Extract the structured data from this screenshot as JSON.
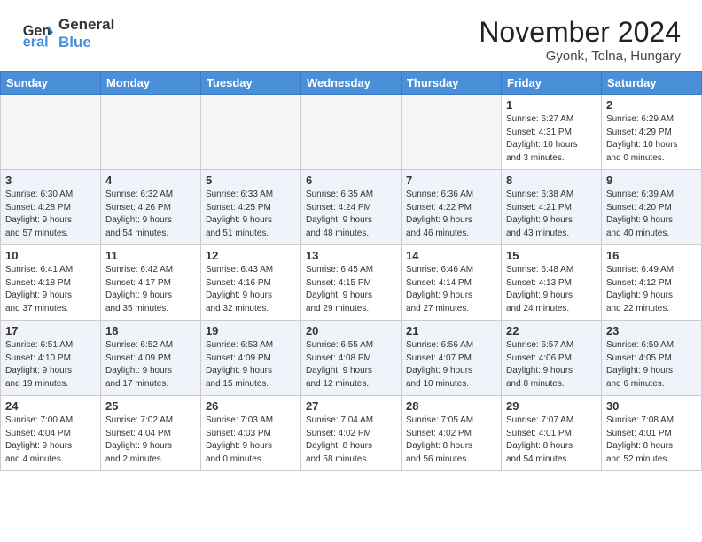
{
  "header": {
    "logo_line1": "General",
    "logo_line2": "Blue",
    "month": "November 2024",
    "location": "Gyonk, Tolna, Hungary"
  },
  "days_of_week": [
    "Sunday",
    "Monday",
    "Tuesday",
    "Wednesday",
    "Thursday",
    "Friday",
    "Saturday"
  ],
  "weeks": [
    [
      {
        "day": "",
        "info": ""
      },
      {
        "day": "",
        "info": ""
      },
      {
        "day": "",
        "info": ""
      },
      {
        "day": "",
        "info": ""
      },
      {
        "day": "",
        "info": ""
      },
      {
        "day": "1",
        "info": "Sunrise: 6:27 AM\nSunset: 4:31 PM\nDaylight: 10 hours\nand 3 minutes."
      },
      {
        "day": "2",
        "info": "Sunrise: 6:29 AM\nSunset: 4:29 PM\nDaylight: 10 hours\nand 0 minutes."
      }
    ],
    [
      {
        "day": "3",
        "info": "Sunrise: 6:30 AM\nSunset: 4:28 PM\nDaylight: 9 hours\nand 57 minutes."
      },
      {
        "day": "4",
        "info": "Sunrise: 6:32 AM\nSunset: 4:26 PM\nDaylight: 9 hours\nand 54 minutes."
      },
      {
        "day": "5",
        "info": "Sunrise: 6:33 AM\nSunset: 4:25 PM\nDaylight: 9 hours\nand 51 minutes."
      },
      {
        "day": "6",
        "info": "Sunrise: 6:35 AM\nSunset: 4:24 PM\nDaylight: 9 hours\nand 48 minutes."
      },
      {
        "day": "7",
        "info": "Sunrise: 6:36 AM\nSunset: 4:22 PM\nDaylight: 9 hours\nand 46 minutes."
      },
      {
        "day": "8",
        "info": "Sunrise: 6:38 AM\nSunset: 4:21 PM\nDaylight: 9 hours\nand 43 minutes."
      },
      {
        "day": "9",
        "info": "Sunrise: 6:39 AM\nSunset: 4:20 PM\nDaylight: 9 hours\nand 40 minutes."
      }
    ],
    [
      {
        "day": "10",
        "info": "Sunrise: 6:41 AM\nSunset: 4:18 PM\nDaylight: 9 hours\nand 37 minutes."
      },
      {
        "day": "11",
        "info": "Sunrise: 6:42 AM\nSunset: 4:17 PM\nDaylight: 9 hours\nand 35 minutes."
      },
      {
        "day": "12",
        "info": "Sunrise: 6:43 AM\nSunset: 4:16 PM\nDaylight: 9 hours\nand 32 minutes."
      },
      {
        "day": "13",
        "info": "Sunrise: 6:45 AM\nSunset: 4:15 PM\nDaylight: 9 hours\nand 29 minutes."
      },
      {
        "day": "14",
        "info": "Sunrise: 6:46 AM\nSunset: 4:14 PM\nDaylight: 9 hours\nand 27 minutes."
      },
      {
        "day": "15",
        "info": "Sunrise: 6:48 AM\nSunset: 4:13 PM\nDaylight: 9 hours\nand 24 minutes."
      },
      {
        "day": "16",
        "info": "Sunrise: 6:49 AM\nSunset: 4:12 PM\nDaylight: 9 hours\nand 22 minutes."
      }
    ],
    [
      {
        "day": "17",
        "info": "Sunrise: 6:51 AM\nSunset: 4:10 PM\nDaylight: 9 hours\nand 19 minutes."
      },
      {
        "day": "18",
        "info": "Sunrise: 6:52 AM\nSunset: 4:09 PM\nDaylight: 9 hours\nand 17 minutes."
      },
      {
        "day": "19",
        "info": "Sunrise: 6:53 AM\nSunset: 4:09 PM\nDaylight: 9 hours\nand 15 minutes."
      },
      {
        "day": "20",
        "info": "Sunrise: 6:55 AM\nSunset: 4:08 PM\nDaylight: 9 hours\nand 12 minutes."
      },
      {
        "day": "21",
        "info": "Sunrise: 6:56 AM\nSunset: 4:07 PM\nDaylight: 9 hours\nand 10 minutes."
      },
      {
        "day": "22",
        "info": "Sunrise: 6:57 AM\nSunset: 4:06 PM\nDaylight: 9 hours\nand 8 minutes."
      },
      {
        "day": "23",
        "info": "Sunrise: 6:59 AM\nSunset: 4:05 PM\nDaylight: 9 hours\nand 6 minutes."
      }
    ],
    [
      {
        "day": "24",
        "info": "Sunrise: 7:00 AM\nSunset: 4:04 PM\nDaylight: 9 hours\nand 4 minutes."
      },
      {
        "day": "25",
        "info": "Sunrise: 7:02 AM\nSunset: 4:04 PM\nDaylight: 9 hours\nand 2 minutes."
      },
      {
        "day": "26",
        "info": "Sunrise: 7:03 AM\nSunset: 4:03 PM\nDaylight: 9 hours\nand 0 minutes."
      },
      {
        "day": "27",
        "info": "Sunrise: 7:04 AM\nSunset: 4:02 PM\nDaylight: 8 hours\nand 58 minutes."
      },
      {
        "day": "28",
        "info": "Sunrise: 7:05 AM\nSunset: 4:02 PM\nDaylight: 8 hours\nand 56 minutes."
      },
      {
        "day": "29",
        "info": "Sunrise: 7:07 AM\nSunset: 4:01 PM\nDaylight: 8 hours\nand 54 minutes."
      },
      {
        "day": "30",
        "info": "Sunrise: 7:08 AM\nSunset: 4:01 PM\nDaylight: 8 hours\nand 52 minutes."
      }
    ]
  ]
}
